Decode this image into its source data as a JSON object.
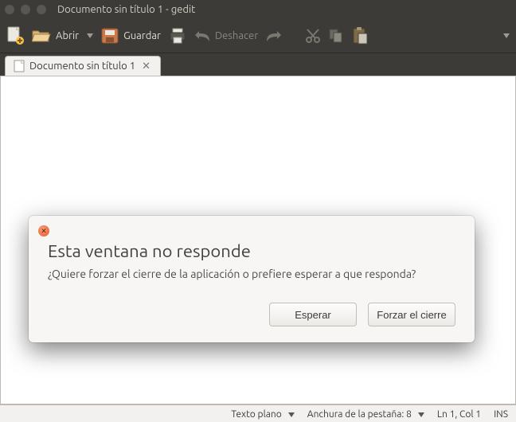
{
  "window": {
    "title": "Documento sin título 1 - gedit"
  },
  "toolbar": {
    "new_icon": "new-file-icon",
    "open_label": "Abrir",
    "save_label": "Guardar",
    "undo_label": "Deshacer"
  },
  "tab": {
    "label": "Documento sin título 1"
  },
  "dialog": {
    "title": "Esta ventana no responde",
    "message": "¿Quiere forzar el cierre de la aplicación o prefiere esperar a que responda?",
    "wait_label": "Esperar",
    "force_label": "Forzar el cierre"
  },
  "status": {
    "syntax_label": "Texto plano",
    "tab_width_label": "Anchura de la pestaña: 8",
    "cursor_label": "Ln 1, Col 1",
    "insert_mode": "INS"
  }
}
